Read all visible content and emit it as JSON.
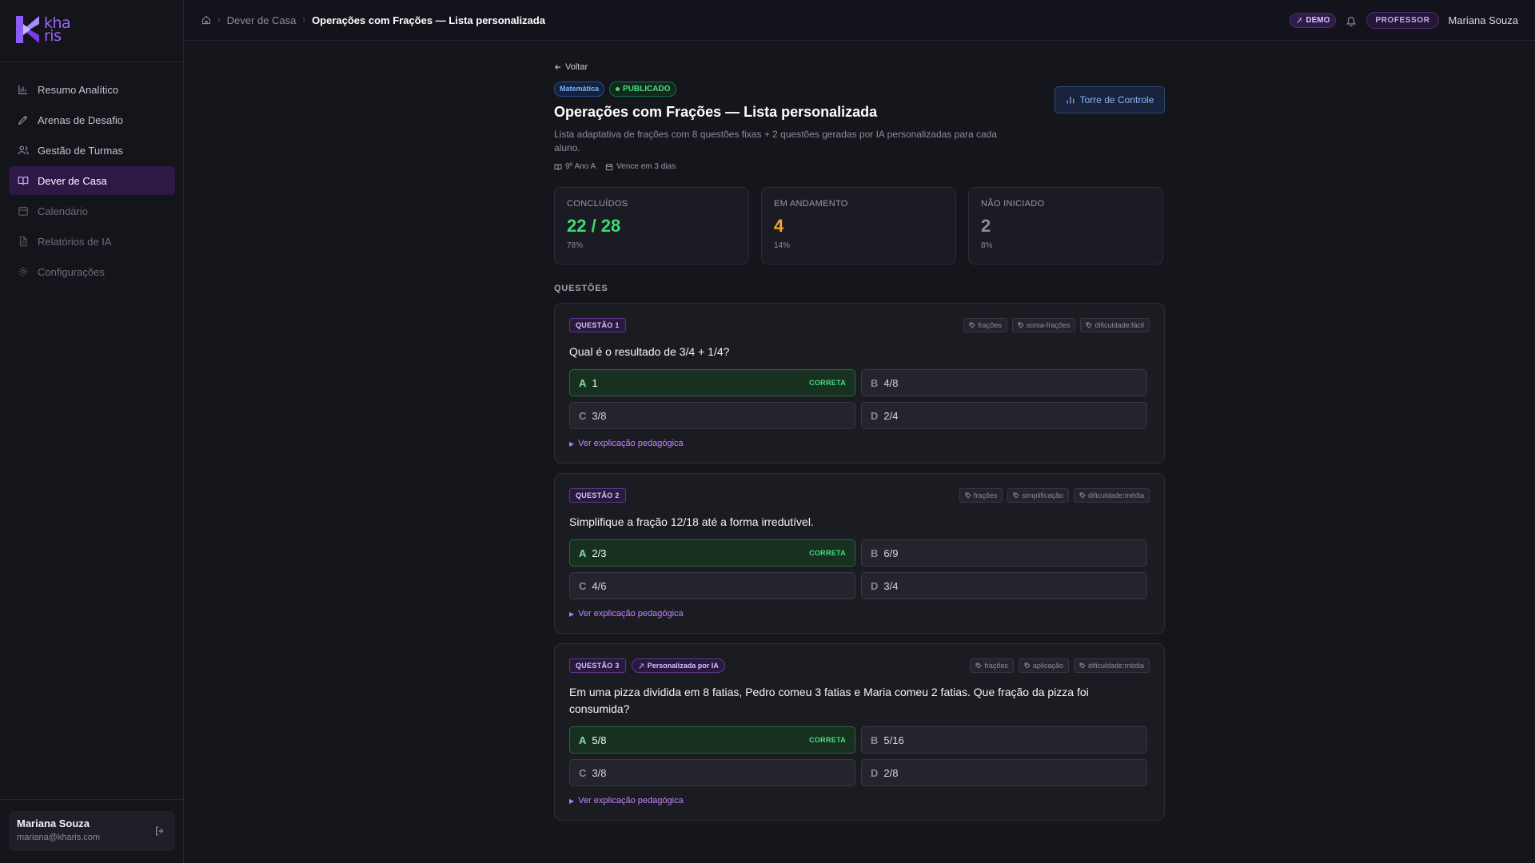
{
  "app": {
    "logo_text": "kha ris",
    "logo_color": "#9d66f5"
  },
  "sidebar": {
    "items": [
      {
        "label": "Resumo Analítico",
        "icon": "bar-chart-icon",
        "state": "normal"
      },
      {
        "label": "Arenas de Desafio",
        "icon": "pen-icon",
        "state": "normal"
      },
      {
        "label": "Gestão de Turmas",
        "icon": "users-icon",
        "state": "normal"
      },
      {
        "label": "Dever de Casa",
        "icon": "book-open-icon",
        "state": "active"
      },
      {
        "label": "Calendário",
        "icon": "calendar-icon",
        "state": "muted"
      },
      {
        "label": "Relatórios de IA",
        "icon": "file-icon",
        "state": "muted"
      },
      {
        "label": "Configurações",
        "icon": "gear-icon",
        "state": "muted"
      }
    ],
    "user": {
      "name": "Mariana Souza",
      "email": "mariana@kharis.com"
    }
  },
  "topbar": {
    "breadcrumb": [
      "Dever de Casa",
      "Operações com Frações — Lista personalizada"
    ],
    "demo_label": "DEMO",
    "role_label": "PROFESSOR",
    "user_name": "Mariana Souza"
  },
  "page": {
    "back_label": "Voltar",
    "subject_badge": "Matemática",
    "status_badge": "PUBLICADO",
    "title": "Operações com Frações — Lista personalizada",
    "description": "Lista adaptativa de frações com 8 questões fixas + 2 questões geradas por IA personalizadas para cada aluno.",
    "class_label": "9º Ano A",
    "due_label": "Vence em 3 dias",
    "control_button": "Torre de Controle"
  },
  "stats": [
    {
      "label": "CONCLUÍDOS",
      "value": "22 / 28",
      "percent": "78%",
      "color": "#3ddc6e"
    },
    {
      "label": "EM ANDAMENTO",
      "value": "4",
      "percent": "14%",
      "color": "#f5a623"
    },
    {
      "label": "NÃO INICIADO",
      "value": "2",
      "percent": "8%",
      "color": "#8d8d9a"
    }
  ],
  "questions_title": "QUESTÕES",
  "correct_label": "CORRETA",
  "explain_label": "Ver explicação pedagógica",
  "ai_badge": "Personalizada por IA",
  "questions": [
    {
      "label": "QUESTÃO 1",
      "tags": [
        "frações",
        "soma-frações",
        "dificuldade:fácil"
      ],
      "text": "Qual é o resultado de 3/4 + 1/4?",
      "options": [
        {
          "letter": "A",
          "text": "1",
          "correct": true
        },
        {
          "letter": "B",
          "text": "4/8",
          "correct": false
        },
        {
          "letter": "C",
          "text": "3/8",
          "correct": false
        },
        {
          "letter": "D",
          "text": "2/4",
          "correct": false
        }
      ]
    },
    {
      "label": "QUESTÃO 2",
      "tags": [
        "frações",
        "simplificação",
        "dificuldade:média"
      ],
      "text": "Simplifique a fração 12/18 até a forma irredutível.",
      "options": [
        {
          "letter": "A",
          "text": "2/3",
          "correct": true
        },
        {
          "letter": "B",
          "text": "6/9",
          "correct": false
        },
        {
          "letter": "C",
          "text": "4/6",
          "correct": false
        },
        {
          "letter": "D",
          "text": "3/4",
          "correct": false
        }
      ]
    },
    {
      "label": "QUESTÃO 3",
      "ai": true,
      "tags": [
        "frações",
        "aplicação",
        "dificuldade:média"
      ],
      "text": "Em uma pizza dividida em 8 fatias, Pedro comeu 3 fatias e Maria comeu 2 fatias. Que fração da pizza foi consumida?",
      "options": [
        {
          "letter": "A",
          "text": "5/8",
          "correct": true
        },
        {
          "letter": "B",
          "text": "5/16",
          "correct": false
        },
        {
          "letter": "C",
          "text": "3/8",
          "correct": false
        },
        {
          "letter": "D",
          "text": "2/8",
          "correct": false
        }
      ]
    }
  ]
}
